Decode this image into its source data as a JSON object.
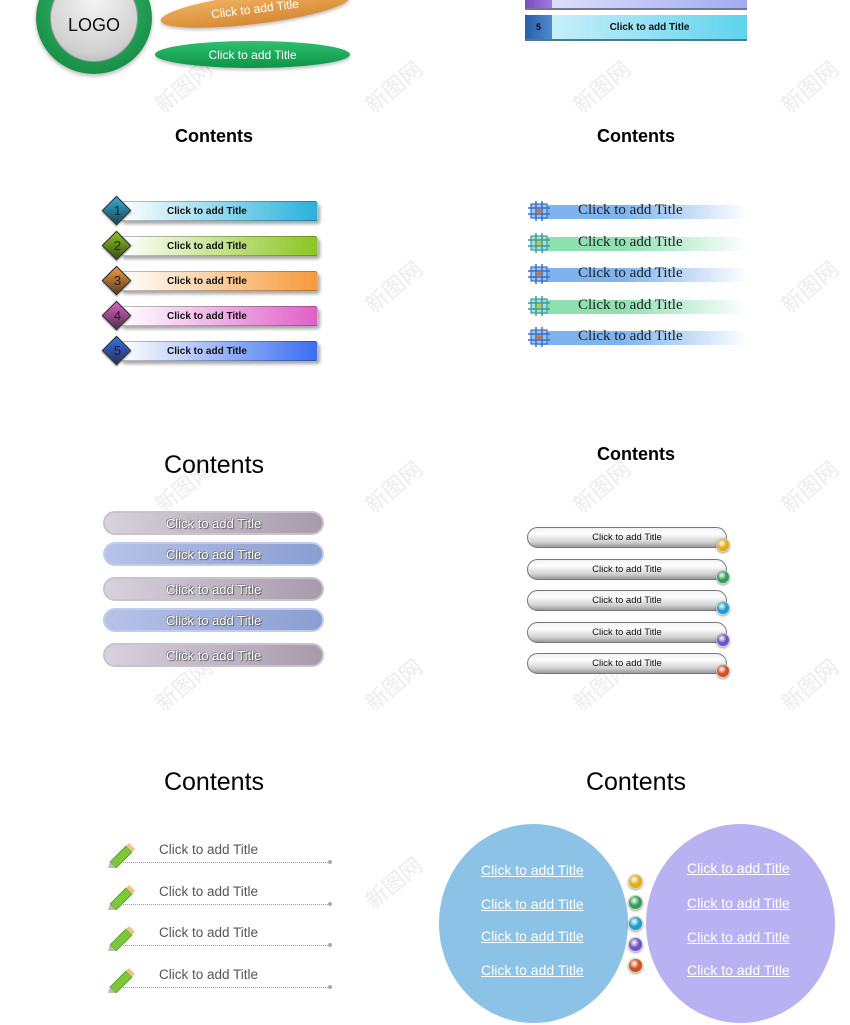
{
  "section_logo_ellipses": {
    "logo_text": "LOGO",
    "ellipse_orange_label": "Click to add Title",
    "ellipse_green_label": "Click to add Title"
  },
  "section_numbered_bars_top": {
    "visible_item_number": "5",
    "visible_item_label": "Click to add Title"
  },
  "section_diamond_list": {
    "heading": "Contents",
    "items": [
      {
        "num": "1",
        "label": "Click to add Title",
        "color": "#2ab0dd"
      },
      {
        "num": "2",
        "label": "Click to add Title",
        "color": "#8cc620"
      },
      {
        "num": "3",
        "label": "Click to add Title",
        "color": "#f59a3a"
      },
      {
        "num": "4",
        "label": "Click to add Title",
        "color": "#e060c8"
      },
      {
        "num": "5",
        "label": "Click to add Title",
        "color": "#3a6ef0"
      }
    ]
  },
  "section_grid_icon_list": {
    "heading": "Contents",
    "items": [
      {
        "label": "Click to add Title",
        "color": "#7fb3f0"
      },
      {
        "label": "Click to add Title",
        "color": "#8fe0b0"
      },
      {
        "label": "Click to add Title",
        "color": "#7fb3f0"
      },
      {
        "label": "Click to add Title",
        "color": "#8fe0b0"
      },
      {
        "label": "Click to add Title",
        "color": "#7fb3f0"
      }
    ]
  },
  "section_pill_list": {
    "heading": "Contents",
    "items": [
      {
        "label": "Click to add Title",
        "variant": "grey"
      },
      {
        "label": "Click to add Title",
        "variant": "blue"
      },
      {
        "label": "Click to add Title",
        "variant": "grey"
      },
      {
        "label": "Click to add Title",
        "variant": "blue"
      },
      {
        "label": "Click to add Title",
        "variant": "grey"
      }
    ]
  },
  "section_chrome_pill_list": {
    "heading": "Contents",
    "items": [
      {
        "label": "Click to add Title",
        "dot_color": "#e0b010"
      },
      {
        "label": "Click to add Title",
        "dot_color": "#2e9e58"
      },
      {
        "label": "Click to add Title",
        "dot_color": "#1a9ed0"
      },
      {
        "label": "Click to add Title",
        "dot_color": "#7050c8"
      },
      {
        "label": "Click to add Title",
        "dot_color": "#d05020"
      }
    ]
  },
  "section_pencil_list": {
    "heading": "Contents",
    "items": [
      {
        "label": "Click to add Title"
      },
      {
        "label": "Click to add Title"
      },
      {
        "label": "Click to add Title"
      },
      {
        "label": "Click to add Title"
      }
    ]
  },
  "section_circles": {
    "heading": "Contents",
    "left_circle_color": "#8cc2e6",
    "right_circle_color": "#b8b2f2",
    "left_items": [
      {
        "label": "Click to add Title"
      },
      {
        "label": "Click to add Title"
      },
      {
        "label": "Click to add Title"
      },
      {
        "label": "Click to add Title"
      }
    ],
    "right_items": [
      {
        "label": "Click to add Title"
      },
      {
        "label": "Click to add Title"
      },
      {
        "label": "Click to add Title"
      },
      {
        "label": "Click to add Title"
      }
    ],
    "dots": [
      "#e0b010",
      "#2e9e58",
      "#1a9ed0",
      "#7050c8",
      "#d05020"
    ]
  },
  "watermark_text": "新图网"
}
